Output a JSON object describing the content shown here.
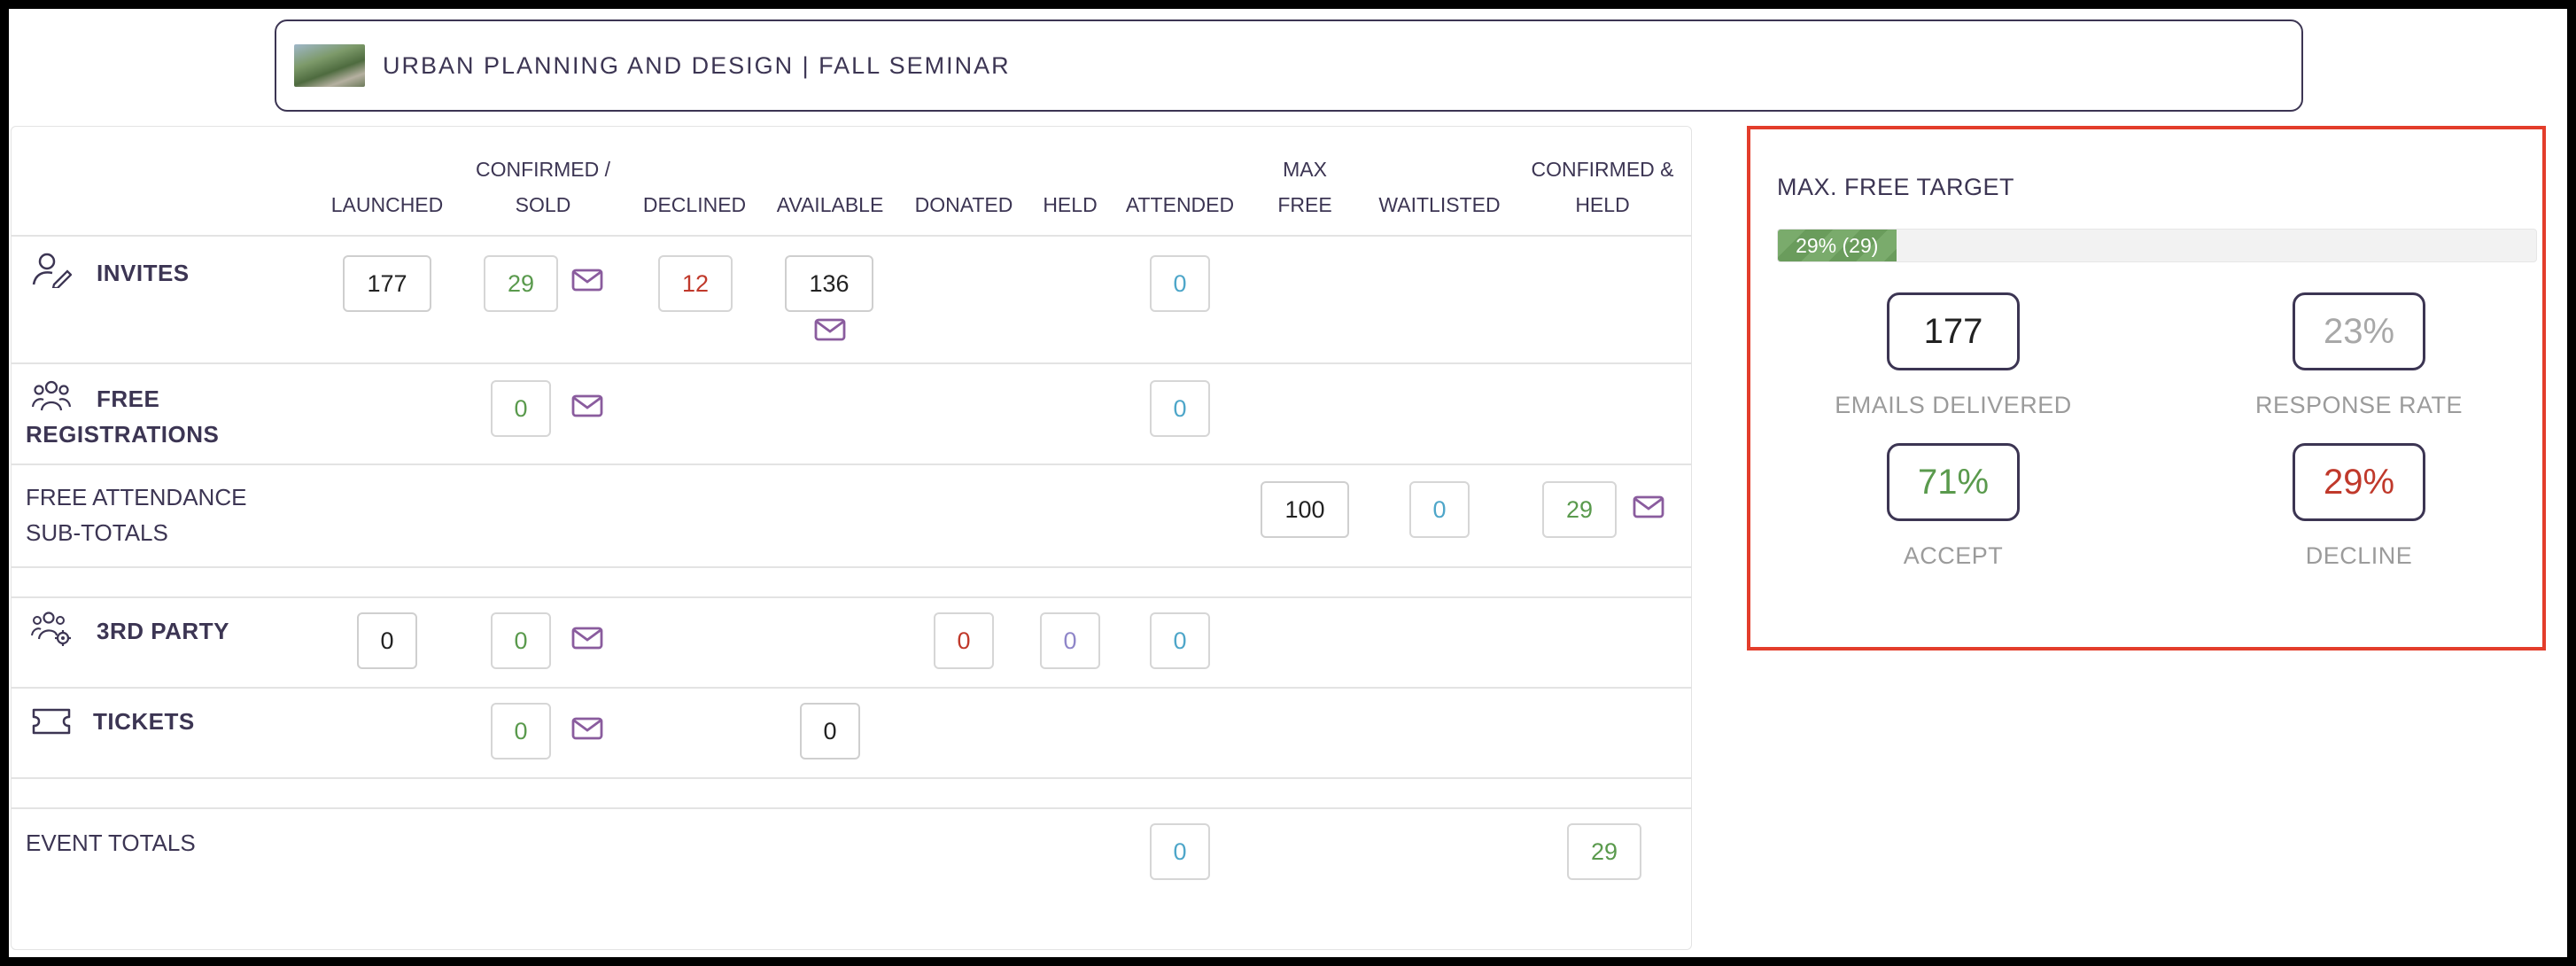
{
  "event": {
    "title": "URBAN PLANNING AND DESIGN | FALL SEMINAR"
  },
  "columns": {
    "launched": "LAUNCHED",
    "confirmed_1": "CONFIRMED /",
    "confirmed_2": "SOLD",
    "declined": "DECLINED",
    "available": "AVAILABLE",
    "donated": "DONATED",
    "held": "HELD",
    "attended": "ATTENDED",
    "max_free_1": "MAX",
    "max_free_2": "FREE",
    "waitlisted": "WAITLISTED",
    "confirmed_held_1": "CONFIRMED &",
    "confirmed_held_2": "HELD"
  },
  "rows": {
    "invites": {
      "label": "INVITES",
      "launched": "177",
      "confirmed": "29",
      "declined": "12",
      "available": "136",
      "attended": "0"
    },
    "free_registrations": {
      "label_1": "FREE",
      "label_2": "REGISTRATIONS",
      "confirmed": "0",
      "attended": "0"
    },
    "free_attendance": {
      "label_1": "FREE ATTENDANCE",
      "label_2": "SUB-TOTALS",
      "max_free": "100",
      "waitlisted": "0",
      "confirmed_held": "29"
    },
    "third_party": {
      "label": "3RD PARTY",
      "launched": "0",
      "confirmed": "0",
      "donated": "0",
      "held": "0",
      "attended": "0"
    },
    "tickets": {
      "label": "TICKETS",
      "confirmed": "0",
      "available": "0"
    },
    "event_totals": {
      "label": "EVENT TOTALS",
      "attended": "0",
      "confirmed_held": "29"
    }
  },
  "summary": {
    "title": "MAX. FREE TARGET",
    "progress_text": "29% (29)",
    "progress_fraction": 0.156,
    "stats": {
      "emails_delivered": {
        "value": "177",
        "label": "EMAILS DELIVERED"
      },
      "response_rate": {
        "value": "23%",
        "label": "RESPONSE RATE"
      },
      "accept": {
        "value": "71%",
        "label": "ACCEPT"
      },
      "decline": {
        "value": "29%",
        "label": "DECLINE"
      }
    }
  },
  "colors": {
    "accent": "#3c3553",
    "highlight": "#e33d2b",
    "green": "#5a9a4d",
    "red": "#c0392b",
    "cyan": "#4ea6c9",
    "violet": "#8f86c9",
    "mail": "#8a5c9e"
  },
  "icons": {
    "invites": "person-edit-icon",
    "free_registrations": "group-icon",
    "third_party": "group-gear-icon",
    "tickets": "ticket-icon",
    "mail": "envelope-icon"
  }
}
